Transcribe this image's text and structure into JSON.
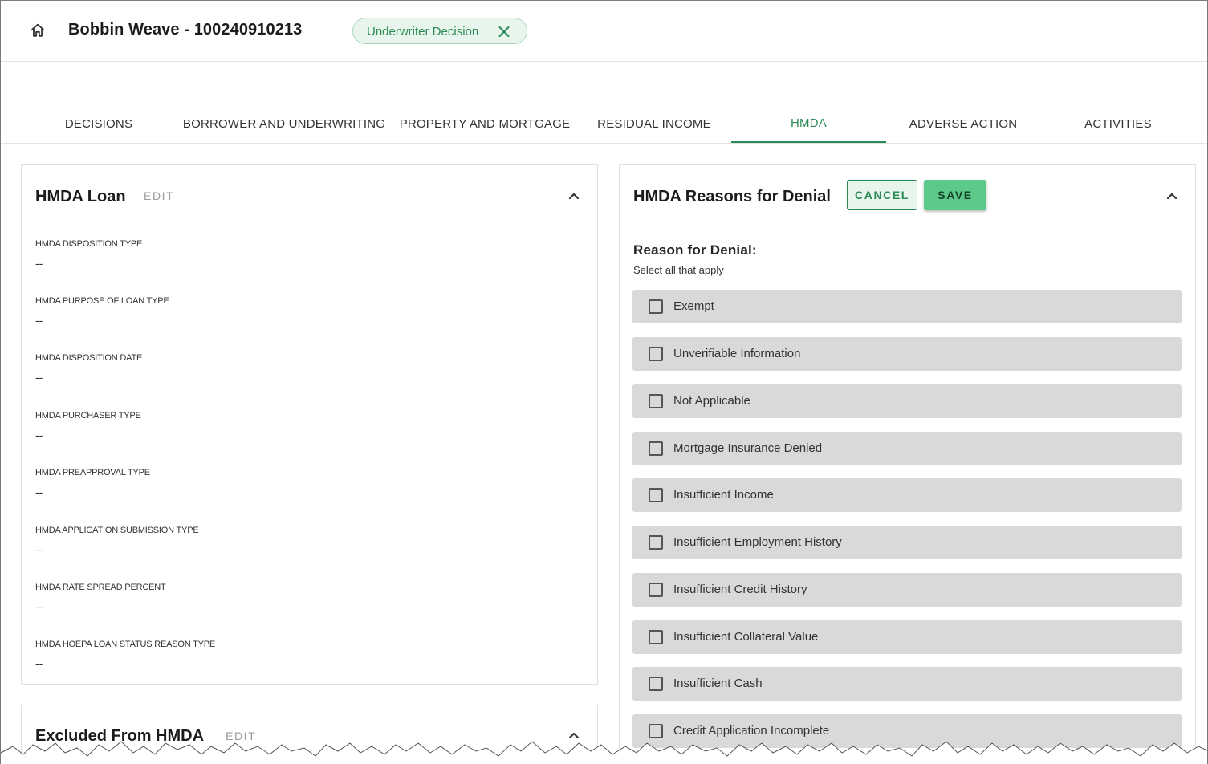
{
  "header": {
    "title": "Bobbin Weave - 100240910213",
    "chip_label": "Underwriter Decision"
  },
  "tabs": [
    {
      "label": "DECISIONS"
    },
    {
      "label": "BORROWER AND UNDERWRITING"
    },
    {
      "label": "PROPERTY AND MORTGAGE"
    },
    {
      "label": "RESIDUAL INCOME"
    },
    {
      "label": "HMDA",
      "active": true
    },
    {
      "label": "ADVERSE ACTION"
    },
    {
      "label": "ACTIVITIES"
    }
  ],
  "hmda_loan": {
    "title": "HMDA Loan",
    "edit_label": "EDIT",
    "fields": [
      {
        "label": "HMDA DISPOSITION TYPE",
        "value": "--"
      },
      {
        "label": "HMDA PURPOSE OF LOAN TYPE",
        "value": "--"
      },
      {
        "label": "HMDA DISPOSITION DATE",
        "value": "--"
      },
      {
        "label": "HMDA PURCHASER TYPE",
        "value": "--"
      },
      {
        "label": "HMDA PREAPPROVAL TYPE",
        "value": "--"
      },
      {
        "label": "HMDA APPLICATION SUBMISSION TYPE",
        "value": "--"
      },
      {
        "label": "HMDA RATE SPREAD PERCENT",
        "value": "--"
      },
      {
        "label": "HMDA HOEPA LOAN STATUS REASON TYPE",
        "value": "--"
      }
    ]
  },
  "excluded": {
    "title": "Excluded From HMDA",
    "edit_label": "EDIT"
  },
  "denial": {
    "title": "HMDA Reasons for Denial",
    "cancel_label": "CANCEL",
    "save_label": "SAVE",
    "heading": "Reason for Denial:",
    "subheading": "Select all that apply",
    "options": [
      {
        "label": "Exempt",
        "checked": false
      },
      {
        "label": "Unverifiable Information",
        "checked": false
      },
      {
        "label": "Not Applicable",
        "checked": false
      },
      {
        "label": "Mortgage Insurance Denied",
        "checked": false
      },
      {
        "label": "Insufficient Income",
        "checked": false
      },
      {
        "label": "Insufficient Employment History",
        "checked": false
      },
      {
        "label": "Insufficient Credit History",
        "checked": false
      },
      {
        "label": "Insufficient Collateral Value",
        "checked": false
      },
      {
        "label": "Insufficient Cash",
        "checked": false
      },
      {
        "label": "Credit Application Incomplete",
        "checked": false
      }
    ]
  },
  "colors": {
    "accent": "#2a8a55",
    "save_button": "#5cc98b",
    "chip_background": "#e8f5ec",
    "option_background": "#d9d9d9"
  }
}
